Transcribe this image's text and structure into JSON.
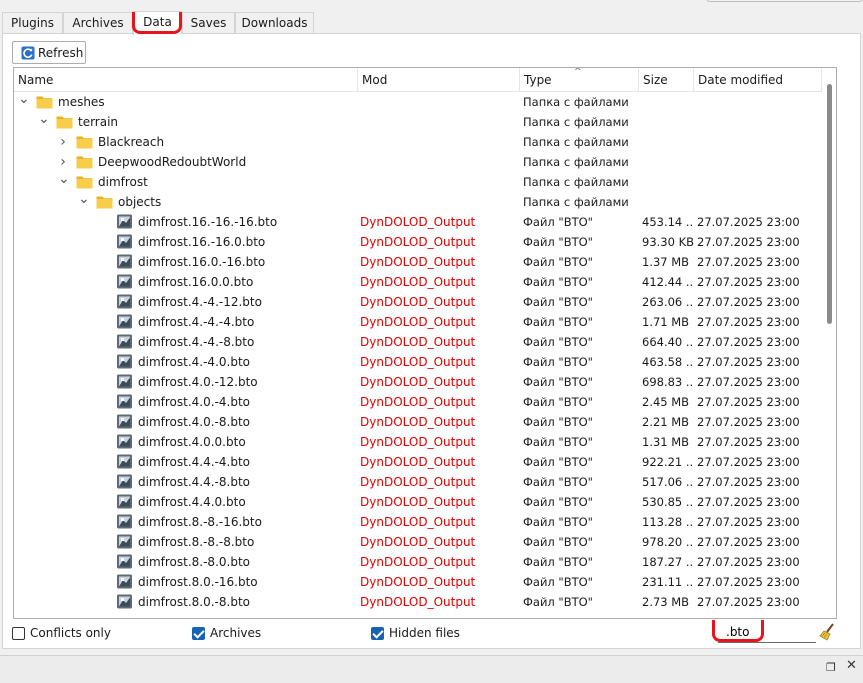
{
  "tabs": [
    "Plugins",
    "Archives",
    "Data",
    "Saves",
    "Downloads"
  ],
  "active_tab": "Data",
  "toolbar": {
    "refresh_label": "Refresh"
  },
  "columns": [
    "Name",
    "Mod",
    "Type",
    "Size",
    "Date modified"
  ],
  "rows": [
    {
      "kind": "folder",
      "level": 0,
      "expanded": true,
      "name": "meshes",
      "mod": "",
      "type": "Папка с файлами",
      "size": "",
      "date": ""
    },
    {
      "kind": "folder",
      "level": 1,
      "expanded": true,
      "name": "terrain",
      "mod": "",
      "type": "Папка с файлами",
      "size": "",
      "date": ""
    },
    {
      "kind": "folder",
      "level": 2,
      "expanded": false,
      "name": "Blackreach",
      "mod": "",
      "type": "Папка с файлами",
      "size": "",
      "date": ""
    },
    {
      "kind": "folder",
      "level": 2,
      "expanded": false,
      "name": "DeepwoodRedoubtWorld",
      "mod": "",
      "type": "Папка с файлами",
      "size": "",
      "date": ""
    },
    {
      "kind": "folder",
      "level": 2,
      "expanded": true,
      "name": "dimfrost",
      "mod": "",
      "type": "Папка с файлами",
      "size": "",
      "date": ""
    },
    {
      "kind": "folder",
      "level": 3,
      "expanded": true,
      "name": "objects",
      "mod": "",
      "type": "Папка с файлами",
      "size": "",
      "date": ""
    },
    {
      "kind": "file",
      "level": 4,
      "name": "dimfrost.16.-16.-16.bto",
      "mod": "DynDOLOD_Output",
      "type": "Файл \"BTO\"",
      "size": "453.14 ...",
      "date": "27.07.2025 23:00"
    },
    {
      "kind": "file",
      "level": 4,
      "name": "dimfrost.16.-16.0.bto",
      "mod": "DynDOLOD_Output",
      "type": "Файл \"BTO\"",
      "size": "93.30 KB",
      "date": "27.07.2025 23:00"
    },
    {
      "kind": "file",
      "level": 4,
      "name": "dimfrost.16.0.-16.bto",
      "mod": "DynDOLOD_Output",
      "type": "Файл \"BTO\"",
      "size": "1.37 MB",
      "date": "27.07.2025 23:00"
    },
    {
      "kind": "file",
      "level": 4,
      "name": "dimfrost.16.0.0.bto",
      "mod": "DynDOLOD_Output",
      "type": "Файл \"BTO\"",
      "size": "412.44 ...",
      "date": "27.07.2025 23:00"
    },
    {
      "kind": "file",
      "level": 4,
      "name": "dimfrost.4.-4.-12.bto",
      "mod": "DynDOLOD_Output",
      "type": "Файл \"BTO\"",
      "size": "263.06 ...",
      "date": "27.07.2025 23:00"
    },
    {
      "kind": "file",
      "level": 4,
      "name": "dimfrost.4.-4.-4.bto",
      "mod": "DynDOLOD_Output",
      "type": "Файл \"BTO\"",
      "size": "1.71 MB",
      "date": "27.07.2025 23:00"
    },
    {
      "kind": "file",
      "level": 4,
      "name": "dimfrost.4.-4.-8.bto",
      "mod": "DynDOLOD_Output",
      "type": "Файл \"BTO\"",
      "size": "664.40 ...",
      "date": "27.07.2025 23:00"
    },
    {
      "kind": "file",
      "level": 4,
      "name": "dimfrost.4.-4.0.bto",
      "mod": "DynDOLOD_Output",
      "type": "Файл \"BTO\"",
      "size": "463.58 ...",
      "date": "27.07.2025 23:00"
    },
    {
      "kind": "file",
      "level": 4,
      "name": "dimfrost.4.0.-12.bto",
      "mod": "DynDOLOD_Output",
      "type": "Файл \"BTO\"",
      "size": "698.83 ...",
      "date": "27.07.2025 23:00"
    },
    {
      "kind": "file",
      "level": 4,
      "name": "dimfrost.4.0.-4.bto",
      "mod": "DynDOLOD_Output",
      "type": "Файл \"BTO\"",
      "size": "2.45 MB",
      "date": "27.07.2025 23:00"
    },
    {
      "kind": "file",
      "level": 4,
      "name": "dimfrost.4.0.-8.bto",
      "mod": "DynDOLOD_Output",
      "type": "Файл \"BTO\"",
      "size": "2.21 MB",
      "date": "27.07.2025 23:00"
    },
    {
      "kind": "file",
      "level": 4,
      "name": "dimfrost.4.0.0.bto",
      "mod": "DynDOLOD_Output",
      "type": "Файл \"BTO\"",
      "size": "1.31 MB",
      "date": "27.07.2025 23:00"
    },
    {
      "kind": "file",
      "level": 4,
      "name": "dimfrost.4.4.-4.bto",
      "mod": "DynDOLOD_Output",
      "type": "Файл \"BTO\"",
      "size": "922.21 ...",
      "date": "27.07.2025 23:00"
    },
    {
      "kind": "file",
      "level": 4,
      "name": "dimfrost.4.4.-8.bto",
      "mod": "DynDOLOD_Output",
      "type": "Файл \"BTO\"",
      "size": "517.06 ...",
      "date": "27.07.2025 23:00"
    },
    {
      "kind": "file",
      "level": 4,
      "name": "dimfrost.4.4.0.bto",
      "mod": "DynDOLOD_Output",
      "type": "Файл \"BTO\"",
      "size": "530.85 ...",
      "date": "27.07.2025 23:00"
    },
    {
      "kind": "file",
      "level": 4,
      "name": "dimfrost.8.-8.-16.bto",
      "mod": "DynDOLOD_Output",
      "type": "Файл \"BTO\"",
      "size": "113.28 ...",
      "date": "27.07.2025 23:00"
    },
    {
      "kind": "file",
      "level": 4,
      "name": "dimfrost.8.-8.-8.bto",
      "mod": "DynDOLOD_Output",
      "type": "Файл \"BTO\"",
      "size": "978.20 ...",
      "date": "27.07.2025 23:00"
    },
    {
      "kind": "file",
      "level": 4,
      "name": "dimfrost.8.-8.0.bto",
      "mod": "DynDOLOD_Output",
      "type": "Файл \"BTO\"",
      "size": "187.27 ...",
      "date": "27.07.2025 23:00"
    },
    {
      "kind": "file",
      "level": 4,
      "name": "dimfrost.8.0.-16.bto",
      "mod": "DynDOLOD_Output",
      "type": "Файл \"BTO\"",
      "size": "231.11 ...",
      "date": "27.07.2025 23:00"
    },
    {
      "kind": "file",
      "level": 4,
      "name": "dimfrost.8.0.-8.bto",
      "mod": "DynDOLOD_Output",
      "type": "Файл \"BTO\"",
      "size": "2.73 MB",
      "date": "27.07.2025 23:00"
    }
  ],
  "footer": {
    "conflicts_only": {
      "label": "Conflicts only",
      "checked": false
    },
    "archives": {
      "label": "Archives",
      "checked": true
    },
    "hidden_files": {
      "label": "Hidden files",
      "checked": true
    },
    "filter_value": ".bto"
  },
  "icons": {
    "folder": "folder-icon",
    "file": "bto-file-icon",
    "refresh": "refresh-icon",
    "clear_filter": "broom-icon",
    "restore": "restore-window-icon",
    "close": "close-icon"
  },
  "colors": {
    "mod_text": "#e00000",
    "highlight_marker": "#e8141b",
    "folder": "#f5c43c",
    "checkbox_on": "#1862b4"
  }
}
